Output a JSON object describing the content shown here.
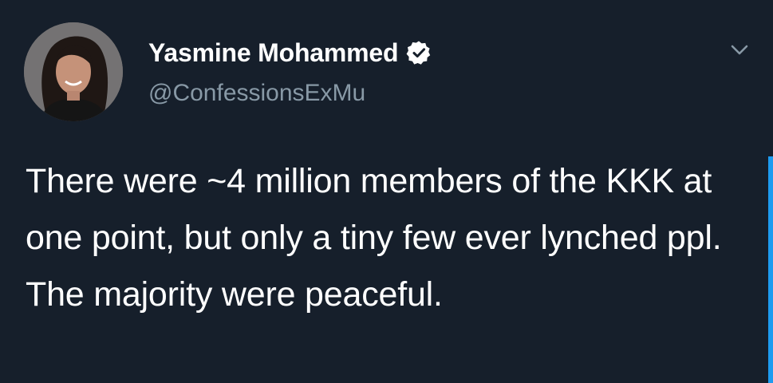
{
  "author": {
    "display_name": "Yasmine Mohammed",
    "handle": "@ConfessionsExMu",
    "verified": true,
    "avatar_icon": "profile-photo-woman-dark-hair"
  },
  "tweet": {
    "text": "There were ~4 million members of the KKK at one point, but only a tiny few ever lynched ppl. The majority were peaceful."
  },
  "menu": {
    "icon": "chevron-down-icon"
  },
  "colors": {
    "background": "#161f2b",
    "primary_text": "#ffffff",
    "secondary_text": "#8899a6",
    "accent": "#1d9bf0"
  }
}
